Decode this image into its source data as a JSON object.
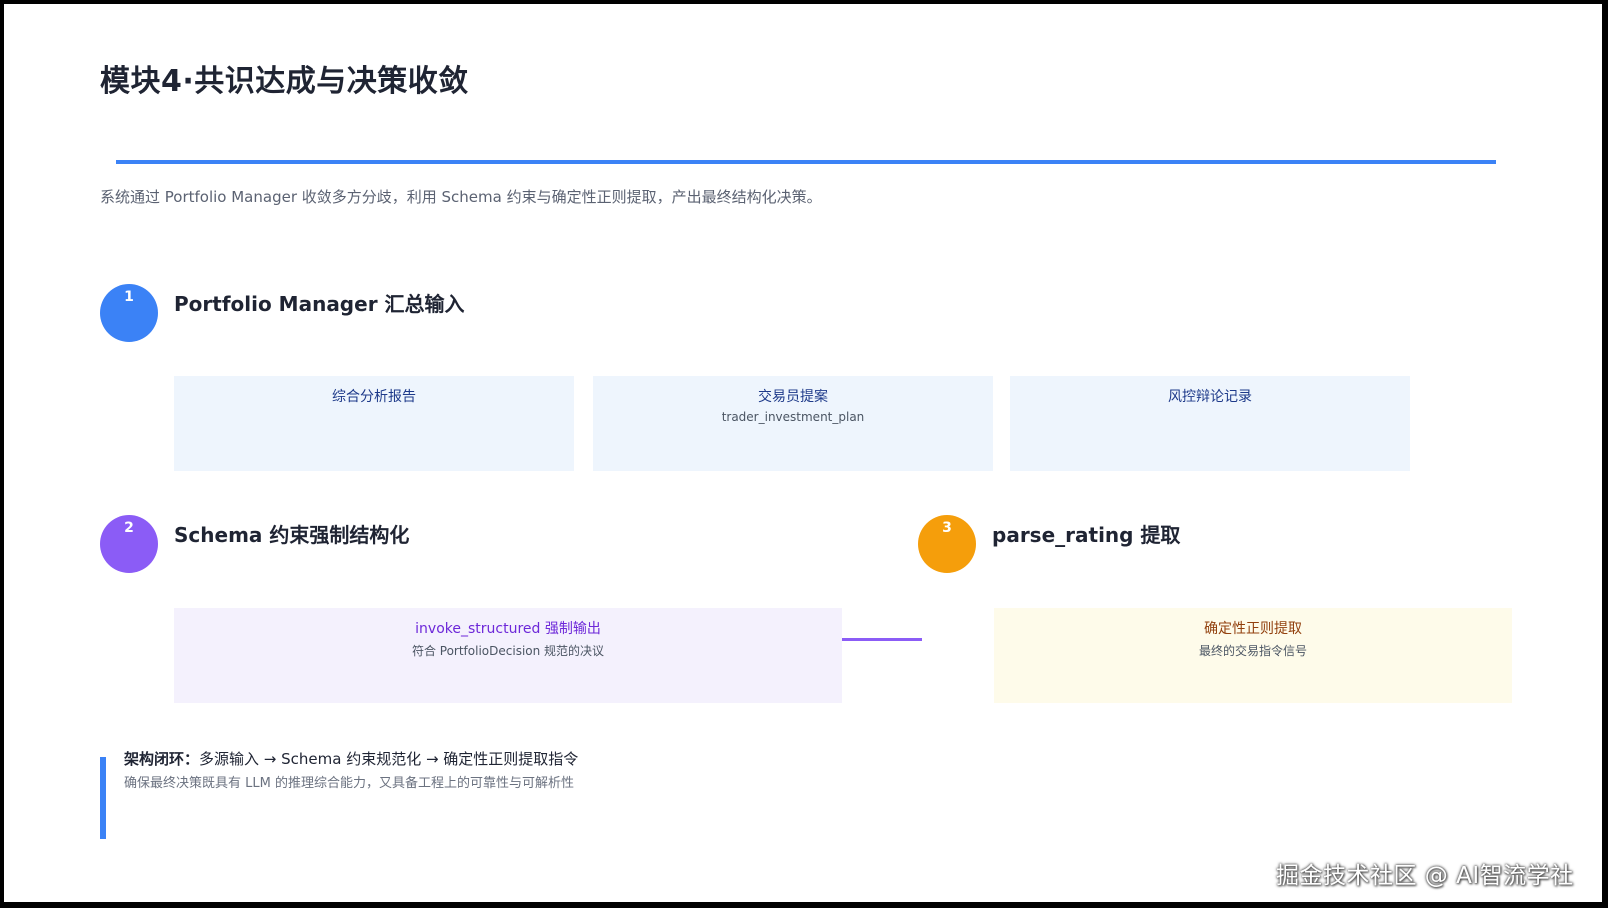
{
  "title": "模块4·共识达成与决策收敛",
  "subtitle": "系统通过 Portfolio Manager 收敛多方分歧，利用 Schema 约束与确定性正则提取，产出最终结构化决策。",
  "colors": {
    "accent_blue": "#3b82f6",
    "accent_purple": "#8b5cf6",
    "accent_orange": "#f59e0b"
  },
  "steps": [
    {
      "number": "1",
      "title": "Portfolio Manager 汇总输入",
      "cards": [
        {
          "title": "综合分析报告",
          "sub": ""
        },
        {
          "title": "交易员提案",
          "sub": "trader_investment_plan"
        },
        {
          "title": "风控辩论记录",
          "sub": ""
        }
      ]
    },
    {
      "number": "2",
      "title": "Schema 约束强制结构化",
      "card": {
        "title": "invoke_structured 强制输出",
        "sub": "符合 PortfolioDecision 规范的决议"
      }
    },
    {
      "number": "3",
      "title": "parse_rating 提取",
      "card": {
        "title": "确定性正则提取",
        "sub": "最终的交易指令信号"
      }
    }
  ],
  "note": {
    "label": "架构闭环：",
    "text": "多源输入 → Schema 约束规范化 → 确定性正则提取指令",
    "detail": "确保最终决策既具有 LLM 的推理综合能力，又具备工程上的可靠性与可解析性"
  },
  "watermark": "掘金技术社区 @ AI智流学社"
}
